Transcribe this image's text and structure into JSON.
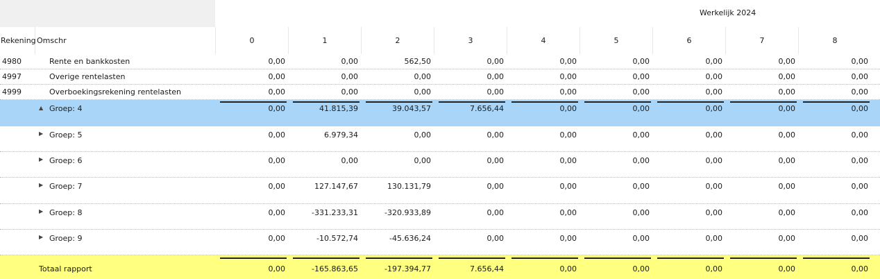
{
  "header": {
    "band_title": "Werkelijk 2024",
    "col_account": "Rekening",
    "col_desc": "Omschr",
    "periods": [
      "0",
      "1",
      "2",
      "3",
      "4",
      "5",
      "6",
      "7",
      "8"
    ]
  },
  "details": [
    {
      "account": "4980",
      "desc": "Rente en bankkosten",
      "values": [
        "0,00",
        "0,00",
        "562,50",
        "0,00",
        "0,00",
        "0,00",
        "0,00",
        "0,00",
        "0,00"
      ]
    },
    {
      "account": "4997",
      "desc": "Overige rentelasten",
      "values": [
        "0,00",
        "0,00",
        "0,00",
        "0,00",
        "0,00",
        "0,00",
        "0,00",
        "0,00",
        "0,00"
      ]
    },
    {
      "account": "4999",
      "desc": "Overboekingsrekening rentelasten",
      "values": [
        "0,00",
        "0,00",
        "0,00",
        "0,00",
        "0,00",
        "0,00",
        "0,00",
        "0,00",
        "0,00"
      ]
    }
  ],
  "groups": [
    {
      "label": "Groep: 4",
      "expanded": true,
      "selected": true,
      "values": [
        "0,00",
        "41.815,39",
        "39.043,57",
        "7.656,44",
        "0,00",
        "0,00",
        "0,00",
        "0,00",
        "0,00"
      ]
    },
    {
      "label": "Groep: 5",
      "expanded": false,
      "selected": false,
      "values": [
        "0,00",
        "6.979,34",
        "0,00",
        "0,00",
        "0,00",
        "0,00",
        "0,00",
        "0,00",
        "0,00"
      ]
    },
    {
      "label": "Groep: 6",
      "expanded": false,
      "selected": false,
      "values": [
        "0,00",
        "0,00",
        "0,00",
        "0,00",
        "0,00",
        "0,00",
        "0,00",
        "0,00",
        "0,00"
      ]
    },
    {
      "label": "Groep: 7",
      "expanded": false,
      "selected": false,
      "values": [
        "0,00",
        "127.147,67",
        "130.131,79",
        "0,00",
        "0,00",
        "0,00",
        "0,00",
        "0,00",
        "0,00"
      ]
    },
    {
      "label": "Groep: 8",
      "expanded": false,
      "selected": false,
      "values": [
        "0,00",
        "-331.233,31",
        "-320.933,89",
        "0,00",
        "0,00",
        "0,00",
        "0,00",
        "0,00",
        "0,00"
      ]
    },
    {
      "label": "Groep: 9",
      "expanded": false,
      "selected": false,
      "values": [
        "0,00",
        "-10.572,74",
        "-45.636,24",
        "0,00",
        "0,00",
        "0,00",
        "0,00",
        "0,00",
        "0,00"
      ]
    }
  ],
  "total": {
    "label": "Totaal rapport",
    "values": [
      "0,00",
      "-165.863,65",
      "-197.394,77",
      "7.656,44",
      "0,00",
      "0,00",
      "0,00",
      "0,00",
      "0,00"
    ]
  },
  "icons": {
    "expanded": "triangle-up-icon",
    "collapsed": "triangle-right-icon"
  },
  "colors": {
    "selected_row": "#a8d5f8",
    "total_row": "#ffff80"
  }
}
